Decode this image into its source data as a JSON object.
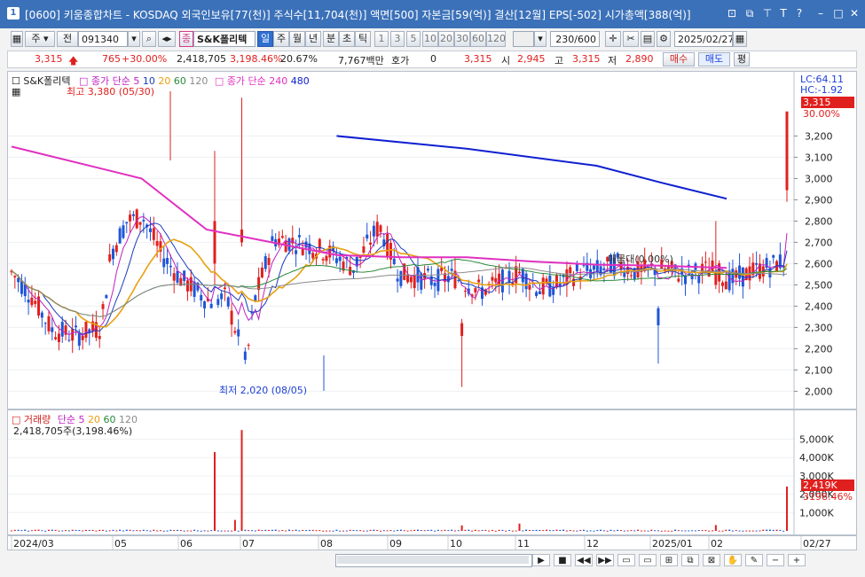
{
  "titlebar": {
    "window_num": "1",
    "title": "[0600] 키움종합차트 - KOSDAQ 외국인보유[77(천)] 주식수[11,704(천)] 액면[500] 자본금[59(억)] 결산[12월] EPS[-502] 시가총액[388(억)]",
    "icons": [
      "restore-window-icon",
      "chart-window-icon",
      "pin-icon",
      "settings-icon",
      "help-icon",
      "minimize-icon",
      "maximize-icon",
      "close-icon"
    ]
  },
  "toolbar": {
    "period": "주",
    "prev": "전",
    "code": "091340",
    "stock_badge": "종",
    "stock_name": "S&K폴리텍",
    "intervals": [
      "일",
      "주",
      "월",
      "년",
      "분",
      "초",
      "틱"
    ],
    "selected_interval": "일",
    "minutes": [
      "1",
      "3",
      "5",
      "10",
      "20",
      "30",
      "60",
      "120"
    ],
    "count": "230/600",
    "date": "2025/02/27"
  },
  "quote": {
    "price": "3,315",
    "change": "765",
    "change_pct": "+30.00%",
    "volume": "2,418,705",
    "volume_pct": "3,198.46%",
    "turnover": "20.67%",
    "amount": "7,767백만",
    "hoga_label": "호가",
    "hoga_value": "0",
    "hoga_price": "3,315",
    "open_label": "시",
    "open": "2,945",
    "high_label": "고",
    "high": "3,315",
    "low_label": "저",
    "low": "2,890",
    "buy": "매수",
    "sell": "매도",
    "avg": "평"
  },
  "price_legend": {
    "name": "S&K폴리텍",
    "ma_label": "종가 단순",
    "ma_periods": [
      "5",
      "10",
      "20",
      "60",
      "120"
    ],
    "ma2_label": "종가 단순",
    "ma2_periods": [
      "240",
      "480"
    ],
    "high_note": "최고 3,380 (05/30)",
    "low_note": "최저 2,020 (08/05)",
    "vwap_note": "매물대(0.00%)",
    "lc": "LC:64.11",
    "hc": "HC:-1.92",
    "last_price": "3,315",
    "last_pct": "30.00%"
  },
  "volume_legend": {
    "label": "거래량",
    "ma_label": "단순",
    "ma_periods": [
      "5",
      "20",
      "60",
      "120"
    ],
    "value": "2,418,705주(3,198.46%)",
    "last": "2,419K",
    "last_pct": "3198.46%"
  },
  "colors": {
    "up": "#e0201e",
    "down": "#1f55d8",
    "ma5": "#c020c0",
    "ma10": "#1a3cbf",
    "ma20": "#e8a010",
    "ma60": "#2a8a3a",
    "ma120": "#8a8a8a",
    "ma240": "#e030c0",
    "ma480": "#1020d0"
  },
  "chart_data": {
    "type": "candlestick",
    "y_ticks": [
      "3,200",
      "3,100",
      "3,000",
      "2,900",
      "2,800",
      "2,700",
      "2,600",
      "2,500",
      "2,400",
      "2,300",
      "2,200",
      "2,100",
      "2,000"
    ],
    "ylim": [
      1960,
      3460
    ],
    "vol_ticks": [
      "5,000K",
      "4,000K",
      "3,000K",
      "2,000K",
      "1,000K"
    ],
    "vol_ylim": [
      0,
      5800
    ],
    "x_labels": [
      "2024/03",
      "05",
      "06",
      "07",
      "08",
      "09",
      "10",
      "11",
      "12",
      "2025/01",
      "02",
      "02/27"
    ],
    "ma240": [
      [
        2024.03,
        3150
      ],
      [
        2024.05,
        3000
      ],
      [
        2024.06,
        2760
      ],
      [
        2024.07,
        2700
      ],
      [
        2024.08,
        2640
      ],
      [
        2024.09,
        2630
      ],
      [
        2024.1,
        2630
      ],
      [
        2024.11,
        2610
      ],
      [
        2024.12,
        2595
      ],
      [
        2025.01,
        2590
      ],
      [
        2025.02,
        2580
      ]
    ],
    "ma480": [
      [
        2024.08,
        3200
      ],
      [
        2024.1,
        3140
      ],
      [
        2024.12,
        3060
      ],
      [
        2025.01,
        2980
      ],
      [
        2025.02,
        2905
      ]
    ],
    "last_close": 3315,
    "last_volume_k": 2419
  },
  "scroll": {
    "icons": [
      "scroll-right-icon",
      "stop-icon",
      "fast-back-icon",
      "fast-forward-icon",
      "zoom-in-icon",
      "zoom-out-icon",
      "grid-icon",
      "copy-icon",
      "link-icon",
      "hand-icon",
      "pen-icon",
      "minus-icon",
      "plus-icon"
    ]
  }
}
